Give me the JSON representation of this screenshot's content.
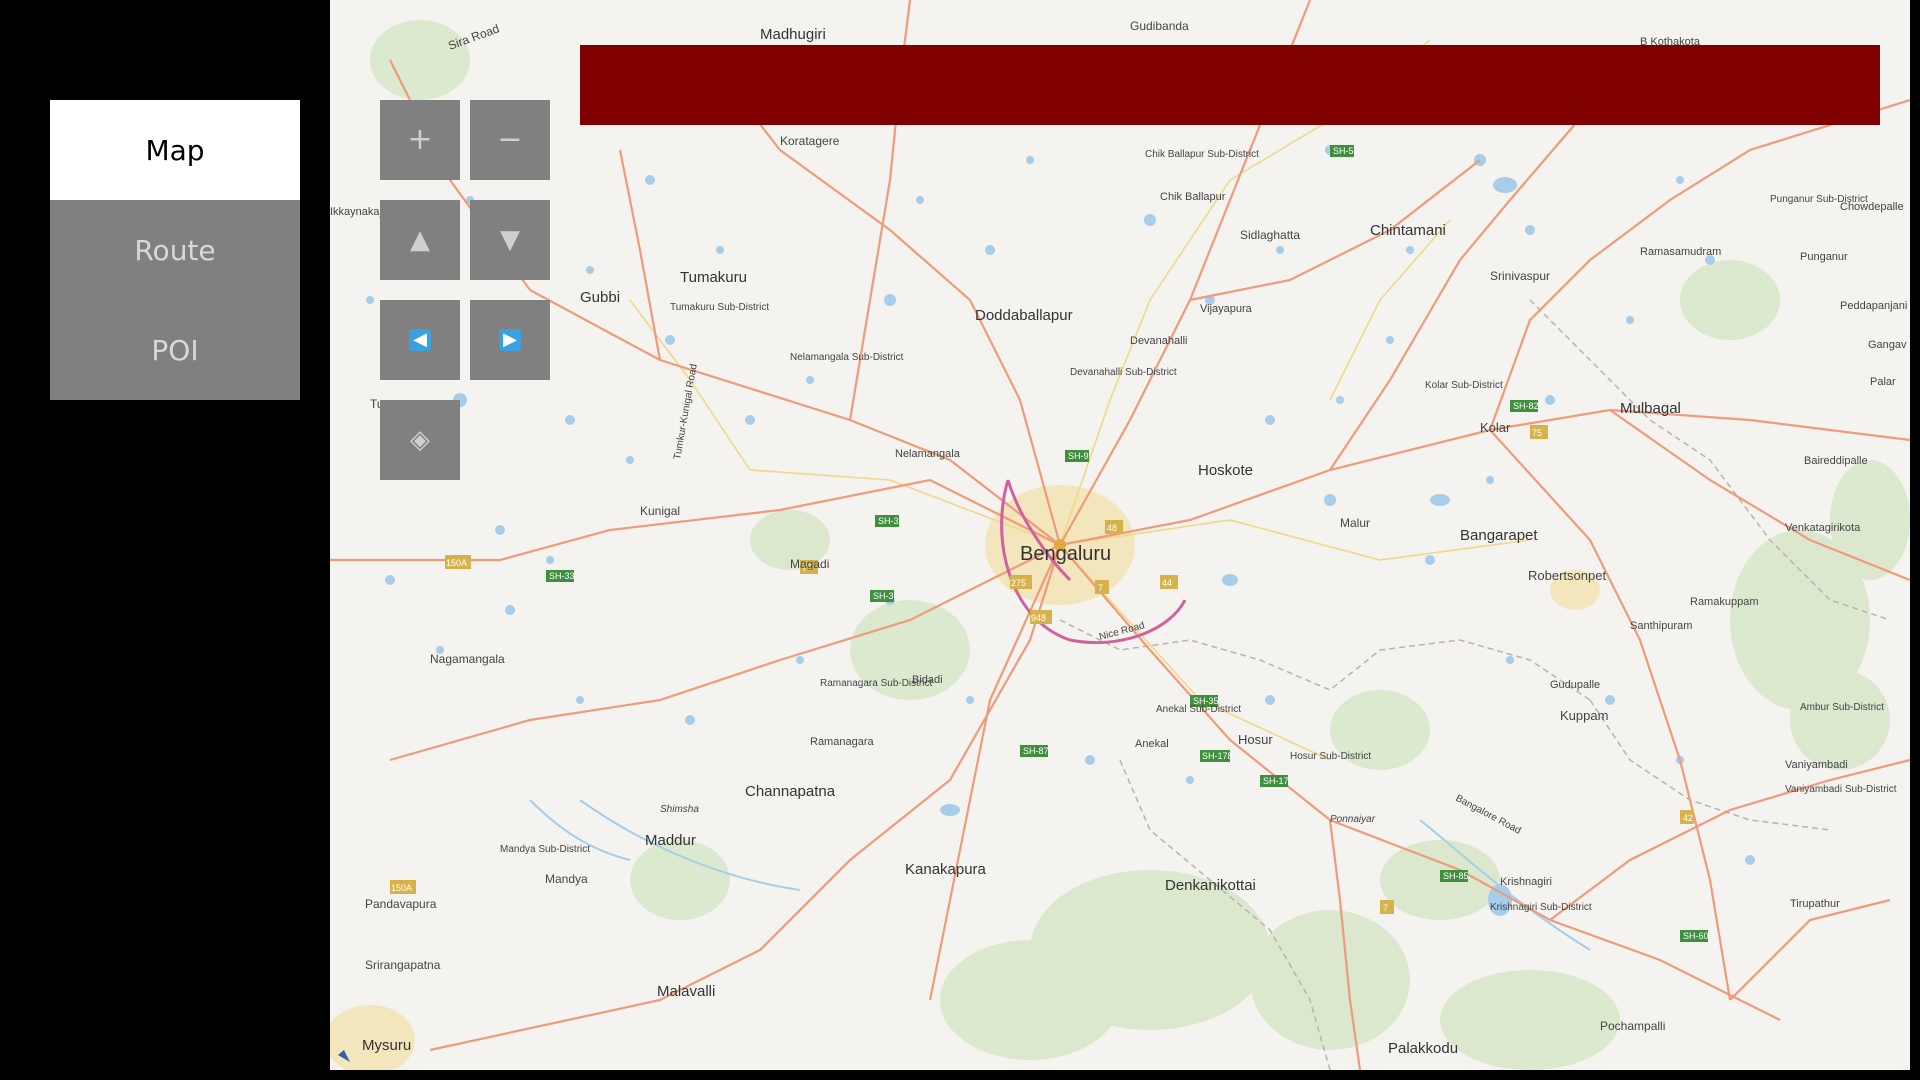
{
  "tabs": [
    {
      "label": "Map",
      "active": true
    },
    {
      "label": "Route",
      "active": false
    },
    {
      "label": "POI",
      "active": false
    }
  ],
  "controls": {
    "zoom_in": "+",
    "zoom_out": "−",
    "pan_up": "▲",
    "pan_down": "▼",
    "pan_left": "◀",
    "pan_right": "▶",
    "recenter": "◈"
  },
  "banner": {
    "color": "#800000",
    "text": ""
  },
  "map": {
    "major_cities": [
      "Bengaluru",
      "Tumakuru",
      "Doddaballapur",
      "Hoskote",
      "Bangarapet",
      "Chintamani",
      "Mulbagal",
      "Channapatna",
      "Kanakapura",
      "Denkanikottai",
      "Malavalli",
      "Maddur",
      "Mysuru",
      "Palakkodu",
      "Madhugiri",
      "Gubbi"
    ],
    "places": [
      "Koratagere",
      "Sira Road",
      "Gudibanda",
      "Chik Ballapur Sub-District",
      "Chik Ballapur",
      "Sidlaghatta",
      "Srinivaspur",
      "Ramasamudram",
      "Punganur Sub-District",
      "Punganur",
      "Chowdepalle",
      "Peddapanjani",
      "Gangav",
      "Palar",
      "Vijayapura",
      "Devanahalli",
      "Devanahalli Sub-District",
      "Nelamangala Sub-District",
      "Tumakuru Sub-District",
      "Nelamangala",
      "Kunigal",
      "Magadi",
      "Bidadi",
      "Ramanagara Sub-District",
      "Ramanagara",
      "Nagamangala",
      "Mandya Sub-District",
      "Mandya",
      "Pandavapura",
      "Srirangapatna",
      "Kolar Sub-District",
      "Kolar",
      "Malur",
      "Robertsonpet",
      "Ramakuppam",
      "Santhipuram",
      "Gudupalle",
      "Kuppam",
      "Venkatagirikota",
      "Baireddipalle",
      "Anekal Sub-District",
      "Anekal",
      "Hosur",
      "Hosur Sub-District",
      "Ponnaiyar",
      "Krishnagiri",
      "Krishnagiri Sub-District",
      "Vaniyambadi",
      "Vaniyambadi Sub-District",
      "Ambur Sub-District",
      "Tirupathur",
      "Pochampalli",
      "Shimsha",
      "Nice Road",
      "Bangalore Road",
      "Tumkur-Kunigal Road",
      "Ikkaynakaj",
      "B Kothakota",
      "Tu"
    ],
    "highways": [
      "NH-4",
      "NH-7",
      "NH-209",
      "NH-234",
      "NH-75",
      "NH-48",
      "NH-44",
      "NH-948",
      "NH-275",
      "NH-150A",
      "SH-3",
      "SH-5",
      "SH-9",
      "SH-33",
      "SH-35",
      "SH-17",
      "SH-60",
      "SH-82",
      "SH-85",
      "SH-87",
      "SH-178"
    ],
    "water_color": "#a6cde9",
    "road_color": "#ef9b7b",
    "ring_road_color": "#d0619f"
  }
}
